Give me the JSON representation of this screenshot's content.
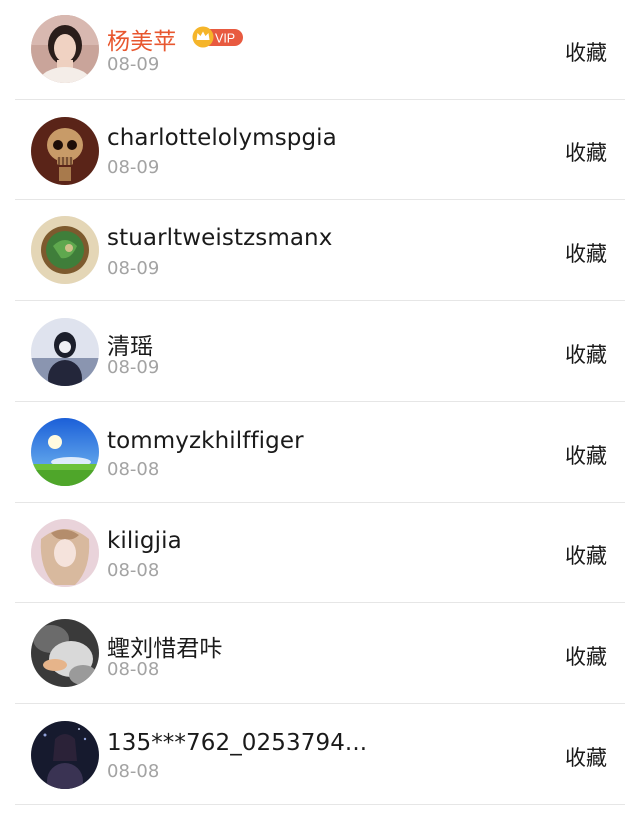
{
  "collect_label": "收藏",
  "vip_label": "VIP",
  "colors": {
    "vip_name": "#e8572f",
    "vip_badge": "#e85a40",
    "crown": "#f5b52a",
    "date": "#a3a3a3"
  },
  "users": [
    {
      "name": "杨美苹",
      "date": "08-09",
      "vip": true,
      "avatar_icon": "avatar-girl-photo-icon"
    },
    {
      "name": "charlottelolymspgia",
      "date": "08-09",
      "vip": false,
      "avatar_icon": "avatar-skull-icon"
    },
    {
      "name": "stuarltweistzsmanx",
      "date": "08-09",
      "vip": false,
      "avatar_icon": "avatar-green-emblem-icon"
    },
    {
      "name": "清瑶",
      "date": "08-09",
      "vip": false,
      "avatar_icon": "avatar-dark-portrait-icon"
    },
    {
      "name": "tommyzkhilffiger",
      "date": "08-08",
      "vip": false,
      "avatar_icon": "avatar-sky-meadow-icon"
    },
    {
      "name": "kiligjia",
      "date": "08-08",
      "vip": false,
      "avatar_icon": "avatar-illustration-icon"
    },
    {
      "name": "蟶刘惜君咔",
      "date": "08-08",
      "vip": false,
      "avatar_icon": "avatar-blurred-photo-icon"
    },
    {
      "name": "135***762_0253794...",
      "date": "08-08",
      "vip": false,
      "avatar_icon": "avatar-night-figure-icon"
    }
  ]
}
